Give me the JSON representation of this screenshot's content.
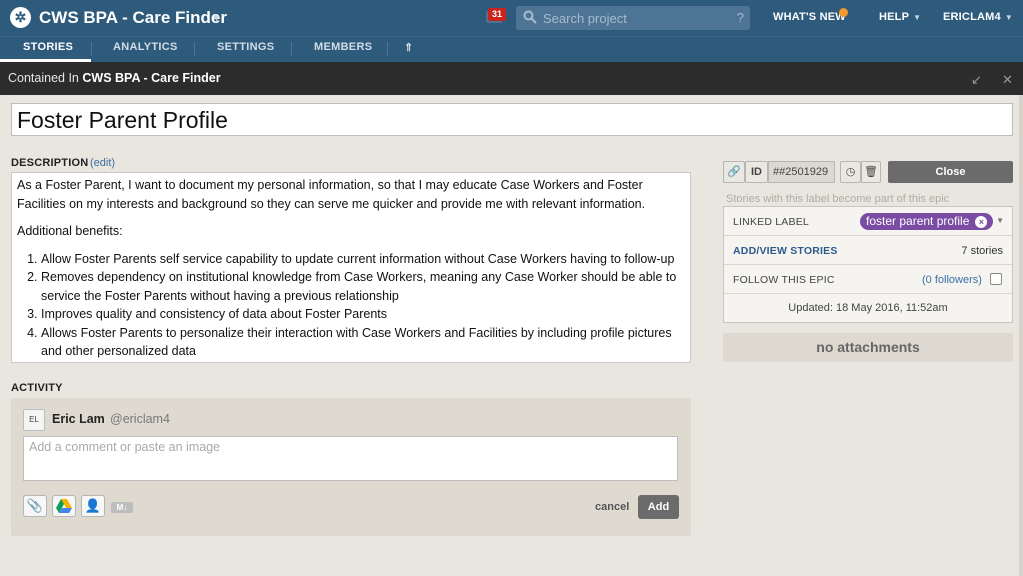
{
  "header": {
    "project_title": "CWS BPA - Care Finder",
    "notification_count": "31",
    "search_placeholder": "Search project",
    "search_help": "?",
    "nav": {
      "whats_new": "WHAT'S NEW",
      "help": "HELP",
      "user": "ERICLAM4"
    }
  },
  "tabs": {
    "stories": "STORIES",
    "analytics": "ANALYTICS",
    "settings": "SETTINGS",
    "members": "MEMBERS",
    "collapse": "⇑"
  },
  "panel": {
    "contained_prefix": "Contained In",
    "contained_project": "CWS BPA - Care Finder"
  },
  "epic": {
    "title": "Foster Parent Profile",
    "description_label": "DESCRIPTION",
    "edit_label": "(edit)",
    "description_intro": "As a Foster Parent, I want to document my personal information, so that I may educate Case Workers and Foster Facilities on my interests and background so they can serve me quicker and provide me with relevant information.",
    "benefits_heading": "Additional benefits:",
    "benefits": [
      "Allow Foster Parents self service capability to update current information without Case Workers having to follow-up",
      "Removes dependency on institutional knowledge from Case Workers, meaning any Case Worker should be able to service the Foster Parents without having a previous relationship",
      "Improves quality and consistency of data about Foster Parents",
      "Allows Foster Parents to personalize their interaction with Case Workers and Facilities by including profile pictures and other personalized data"
    ]
  },
  "activity": {
    "label": "ACTIVITY",
    "avatar_initials": "EL",
    "user_name": "Eric Lam",
    "user_handle": "@ericlam4",
    "comment_placeholder": "Add a comment or paste an image",
    "markdown_badge": "M↓",
    "cancel_label": "cancel",
    "add_label": "Add"
  },
  "sidebar": {
    "id_label": "ID",
    "id_value": "##2501929",
    "close_label": "Close",
    "epic_hint": "Stories with this label become part of this epic",
    "linked_label_title": "LINKED LABEL",
    "linked_label_value": "foster parent profile",
    "add_view_stories": "ADD/VIEW STORIES",
    "stories_count": "7 stories",
    "follow_title": "FOLLOW THIS EPIC",
    "followers": "(0 followers)",
    "updated": "Updated: 18 May 2016, 11:52am",
    "attachments": "no attachments"
  },
  "colors": {
    "header_bg": "#2e5a7c",
    "panel_head_bg": "#2c2c2c",
    "label_pill": "#7b4ca3",
    "notification_badge": "#c9251e",
    "whats_new_dot": "#f39a2b"
  }
}
